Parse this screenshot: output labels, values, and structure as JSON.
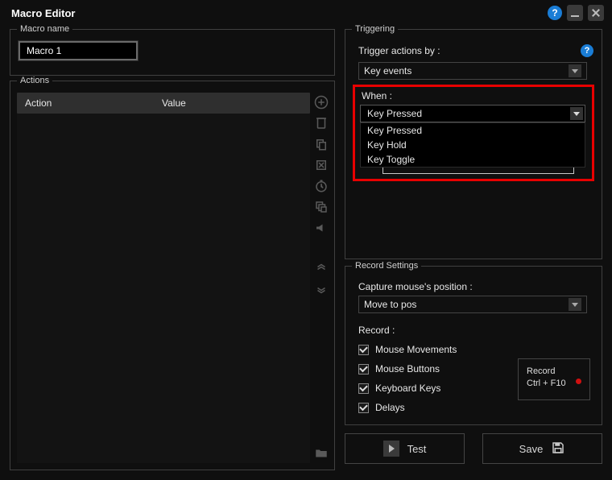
{
  "window": {
    "title": "Macro Editor"
  },
  "macro_name": {
    "legend": "Macro name",
    "value": "Macro 1"
  },
  "actions": {
    "legend": "Actions",
    "columns": {
      "action": "Action",
      "value": "Value"
    },
    "side_icons": [
      "add-icon",
      "delete-icon",
      "duplicate-icon",
      "cut-icon",
      "stopwatch-icon",
      "stack-icon",
      "bullhorn-icon"
    ],
    "move_icons": [
      "move-up-icon",
      "move-down-icon"
    ],
    "folder_icon": "folder-icon"
  },
  "triggering": {
    "legend": "Triggering",
    "trigger_by_label": "Trigger actions by :",
    "trigger_by_value": "Key events",
    "when_label": "When :",
    "when_value": "Key Pressed",
    "when_options": [
      "Key Pressed",
      "Key Hold",
      "Key Toggle"
    ]
  },
  "record_settings": {
    "legend": "Record Settings",
    "capture_label": "Capture mouse's position :",
    "capture_value": "Move to pos",
    "record_label": "Record :",
    "checks": {
      "mouse_movements": "Mouse Movements",
      "mouse_buttons": "Mouse Buttons",
      "keyboard_keys": "Keyboard Keys",
      "delays": "Delays"
    },
    "record_button": {
      "line1": "Record",
      "line2": "Ctrl + F10"
    }
  },
  "footer": {
    "test": "Test",
    "save": "Save"
  }
}
